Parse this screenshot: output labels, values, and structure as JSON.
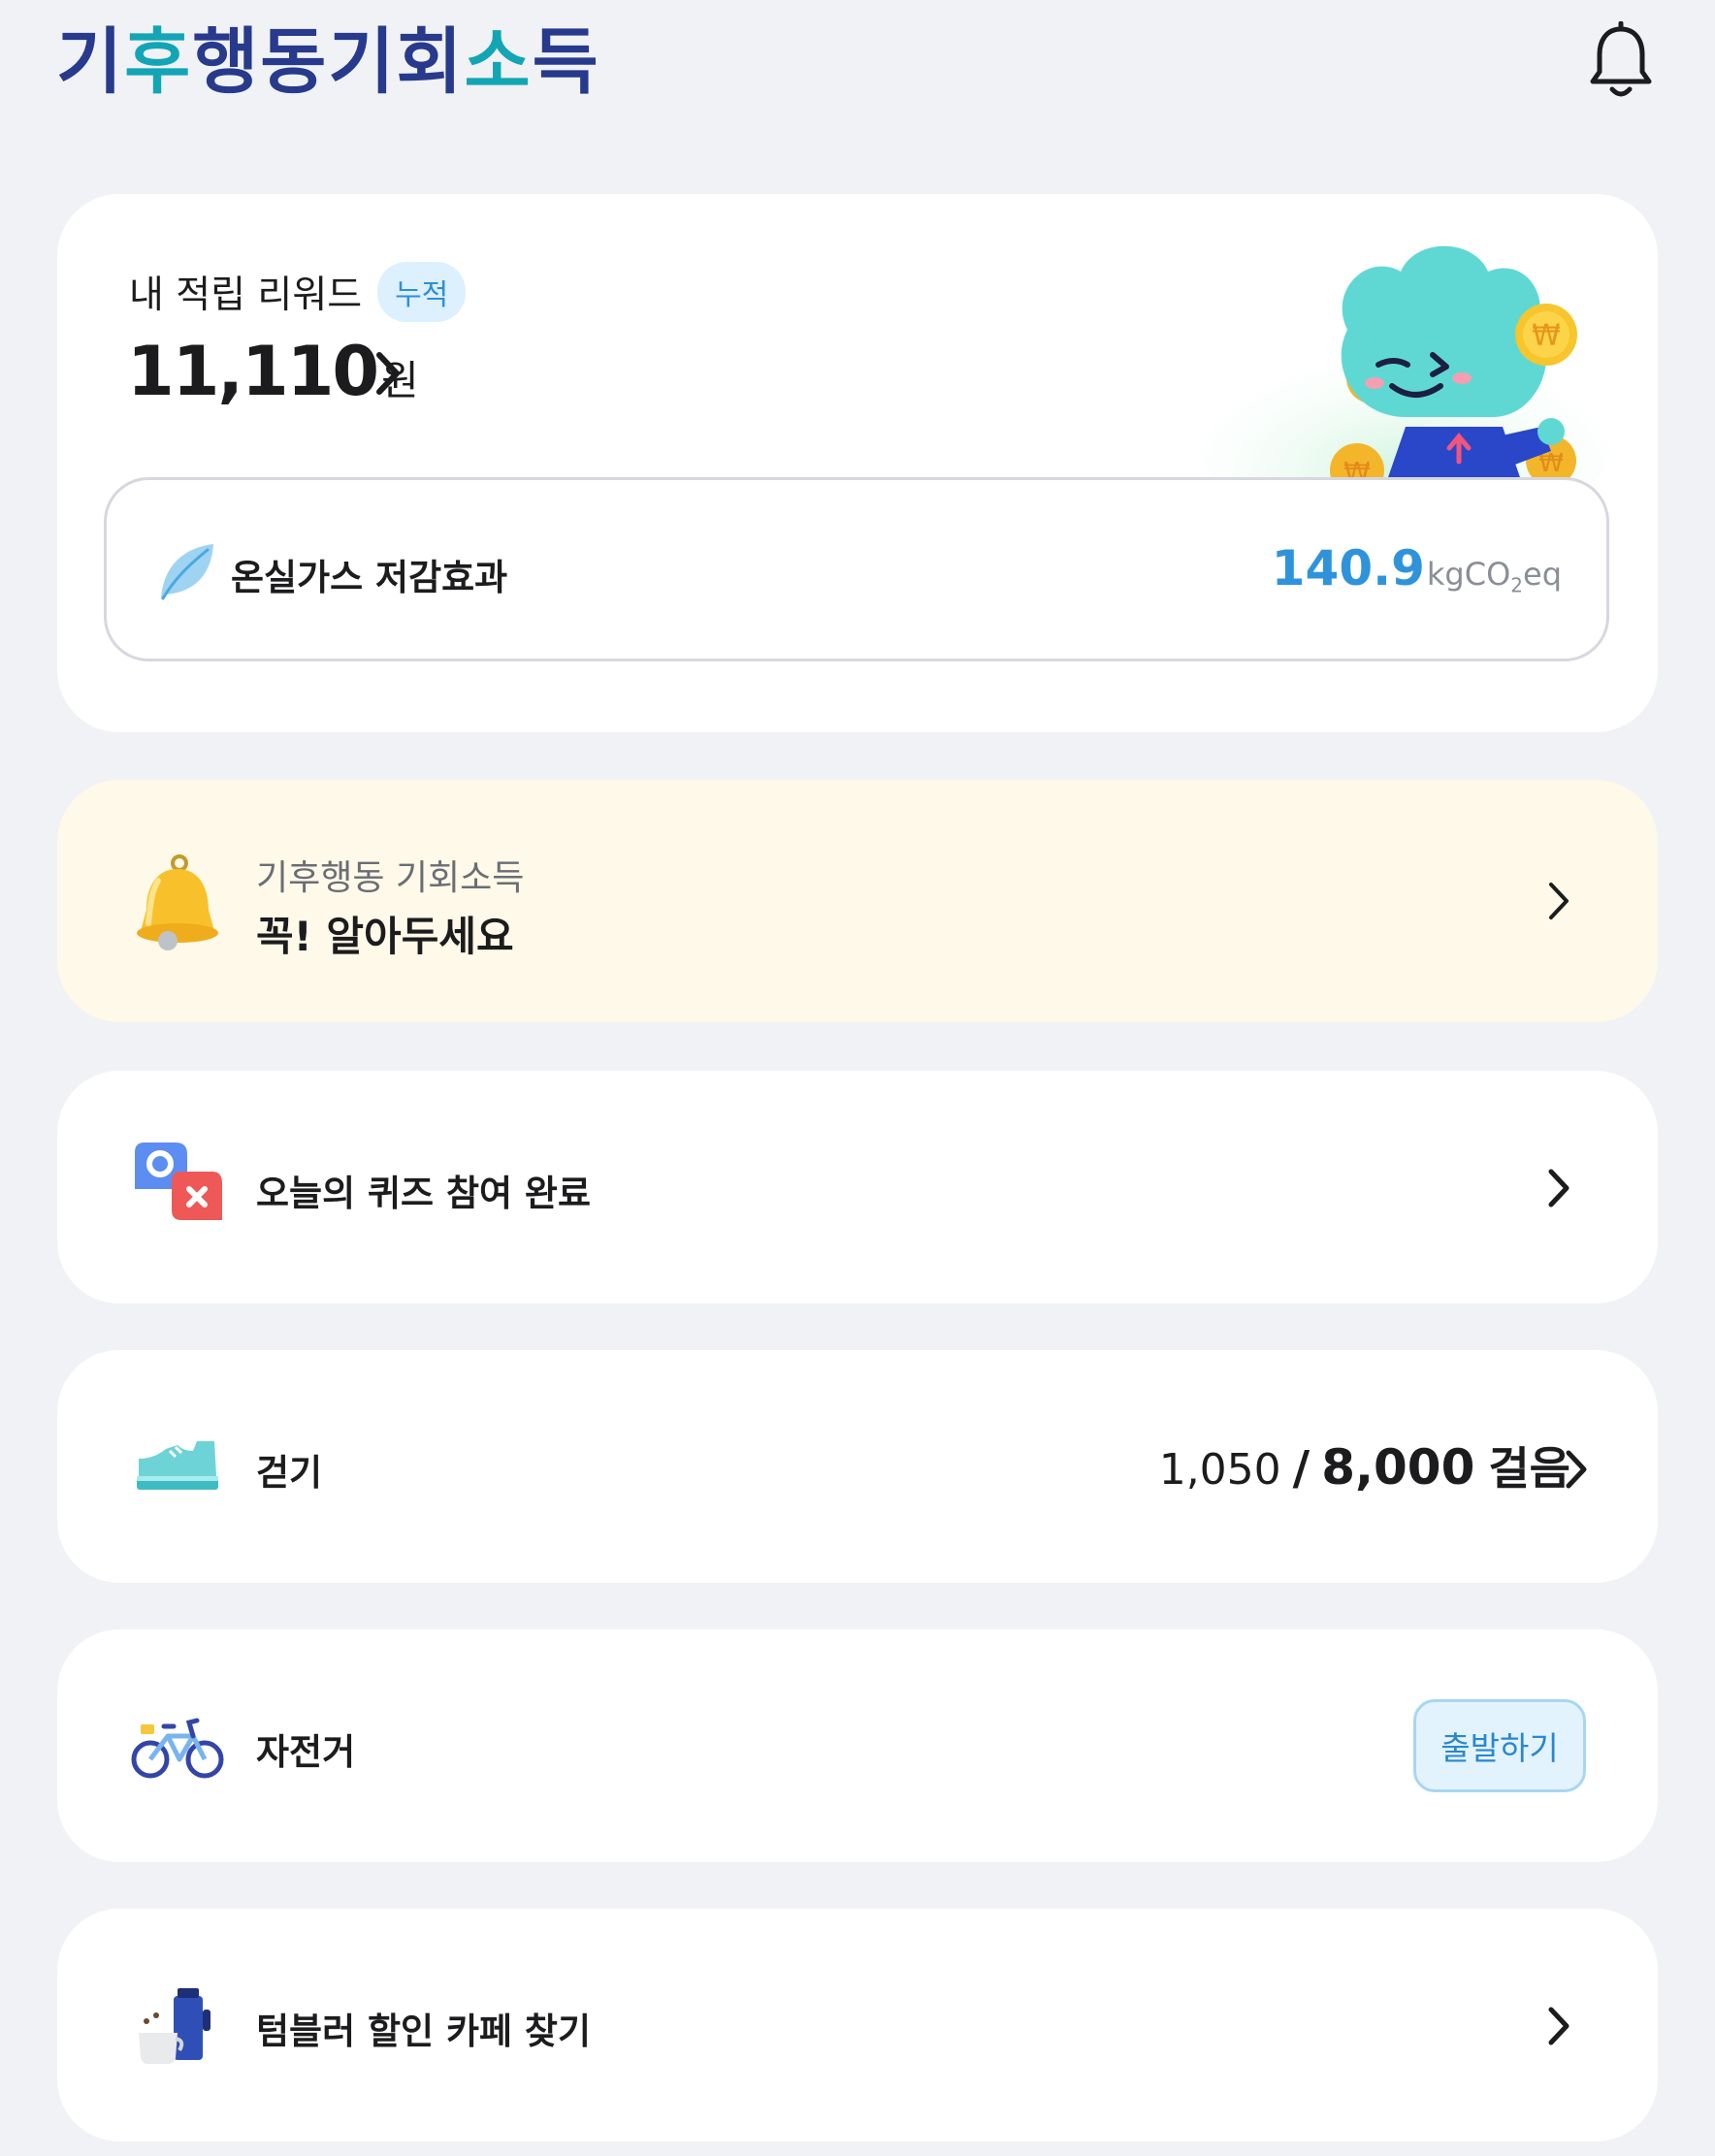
{
  "header": {
    "logo": "기후행동기회소득",
    "logo_parts": [
      "기",
      "후",
      "행동",
      "기회",
      "소",
      "득"
    ],
    "notification_icon": "bell-icon"
  },
  "reward": {
    "label": "내 적립 리워드",
    "badge": "누적",
    "amount": "11,110",
    "unit": "원",
    "ghg": {
      "label": "온실가스 저감효과",
      "value": "140.9",
      "unit_prefix": "kgCO",
      "unit_sub": "2",
      "unit_suffix": "eq"
    }
  },
  "notice": {
    "subtitle": "기후행동 기회소득",
    "title": "꼭! 알아두세요"
  },
  "quiz": {
    "label": "오늘의 퀴즈 참여 완료"
  },
  "walk": {
    "label": "걷기",
    "current": "1,050",
    "separator": "/",
    "goal": "8,000",
    "unit": "걸음"
  },
  "bike": {
    "label": "자전거",
    "button": "출발하기"
  },
  "cafe": {
    "label": "텀블러 할인 카페 찾기"
  },
  "colors": {
    "background": "#f1f2f5",
    "brand": "#273a8c",
    "accent": "#2f93dc",
    "notice_bg": "#fef9e8"
  }
}
